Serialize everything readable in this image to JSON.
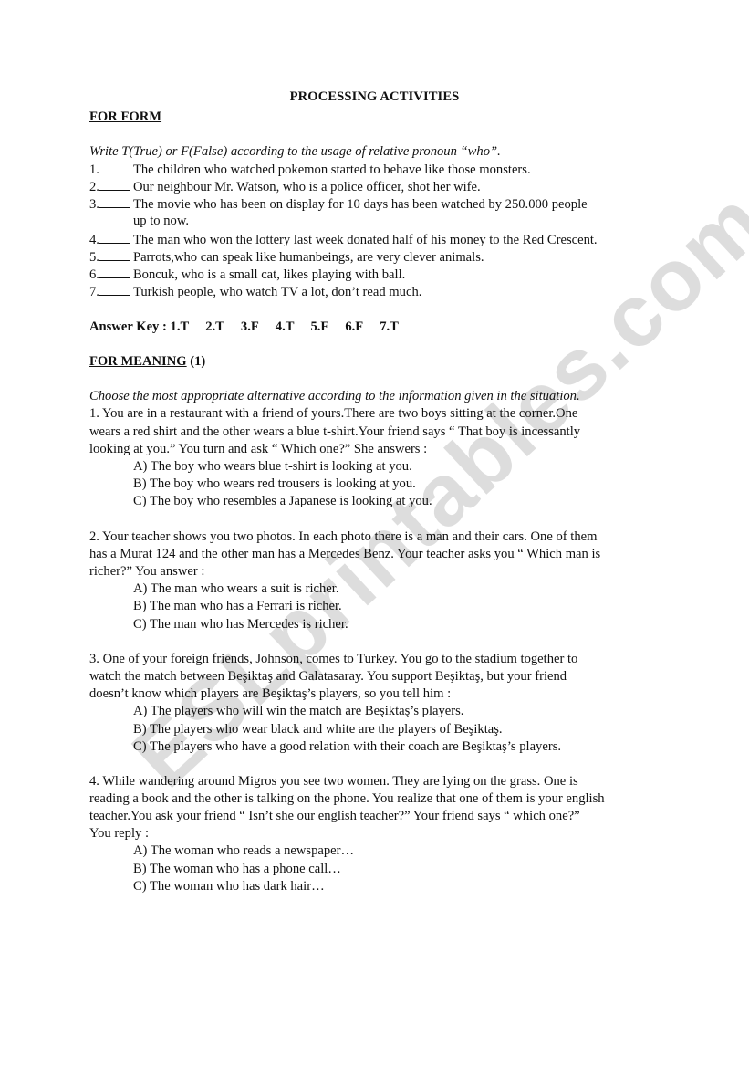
{
  "document": {
    "title": "PROCESSING ACTIVITIES",
    "watermark": "ESLprintables.com",
    "form_section": {
      "heading": "FOR FORM",
      "instruction": "Write T(True) or  F(False) according to the usage of relative pronoun “who”.",
      "items": [
        {
          "num": "1.",
          "text": "The children who watched pokemon started to behave like those monsters."
        },
        {
          "num": "2.",
          "text": "Our neighbour Mr. Watson, who is a police officer, shot her wife."
        },
        {
          "num": "3.",
          "text": "The movie who has been on display for 10 days has been watched by 250.000 people",
          "continuation": "up to now."
        },
        {
          "num": "4.",
          "text": "The man who won the lottery last week donated half of his money to the Red Crescent."
        },
        {
          "num": "5.",
          "text": "Parrots,who can speak like humanbeings, are very clever animals."
        },
        {
          "num": "6.",
          "text": "Boncuk, who is a small cat, likes playing with ball."
        },
        {
          "num": "7.",
          "text": "Turkish people, who watch TV a lot, don’t read much."
        }
      ],
      "answer_key_label": "Answer Key :",
      "answer_key": [
        "1.T",
        "2.T",
        "3.F",
        "4.T",
        "5.F",
        "6.F",
        "7.T"
      ]
    },
    "meaning_section": {
      "heading": "FOR MEANING",
      "heading_suffix": " (1)",
      "instruction": "Choose the most appropriate alternative according to the information given in the situation.",
      "questions": [
        {
          "lines": [
            "1. You are in a restaurant with a friend of yours.There are two boys sitting at the corner.One",
            "wears a red shirt and the other wears a blue t-shirt.Your friend says “ That boy is incessantly",
            "looking at you.”  You turn and ask “ Which one?” She answers :"
          ],
          "options": [
            "A) The boy who wears blue t-shirt is looking at you.",
            "B) The boy who wears red trousers is looking at you.",
            "C) The boy who resembles a Japanese is looking at you."
          ]
        },
        {
          "lines": [
            "2. Your teacher shows you two photos. In each photo there is a man and their cars. One of them",
            "has a Murat 124 and the other man has a Mercedes Benz. Your teacher  asks you “ Which man is",
            "richer?” You answer :"
          ],
          "options": [
            "A) The man who wears a suit is richer.",
            "B) The man who has a Ferrari is richer.",
            "C) The man who has Mercedes is richer."
          ]
        },
        {
          "lines": [
            "3. One of your foreign friends, Johnson, comes to Turkey.  You go to the stadium together  to",
            "watch the match between Beşiktaş and Galatasaray.  You support Beşiktaş, but your friend",
            "doesn’t know which players are Beşiktaş’s players, so you tell him :"
          ],
          "options": [
            "A) The players who will win the match are Beşiktaş’s players.",
            "B) The players who wear black and white are the players of Beşiktaş.",
            "C) The players who have a good relation with their coach are Beşiktaş’s players."
          ]
        },
        {
          "lines": [
            "4. While wandering around Migros you see two women. They are lying on the grass. One is",
            "reading a book and the other is talking on the phone. You realize that one of them is your english",
            "teacher.You ask your friend “ Isn’t she our english teacher?” Your friend says “ which one?”",
            "You reply :"
          ],
          "options": [
            "A) The woman who reads a newspaper…",
            "B) The woman who has a phone call…",
            "C) The woman who has dark hair…"
          ]
        }
      ]
    }
  }
}
